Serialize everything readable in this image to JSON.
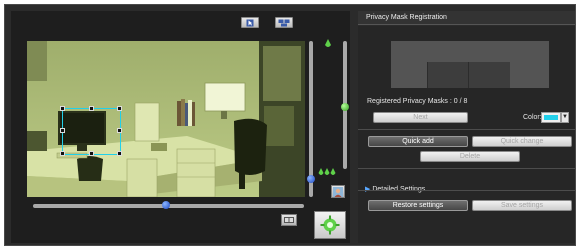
{
  "panel": {
    "title": "Privacy Mask Registration",
    "registered_label": "Registered Privacy Masks : 0 / 8",
    "next_label": "Next",
    "color_label": "Color:",
    "color_value": "#22d0ea",
    "dropdown_arrow": "▼",
    "quick_add_label": "Quick add",
    "quick_change_label": "Quick change",
    "delete_label": "Delete",
    "detailed_settings_label": "Detailed Settings",
    "expand_arrow": "▶",
    "restore_label": "Restore settings",
    "save_label": "Save settings"
  },
  "camera": {
    "view_toggle_icons": [
      "pointer-view-icon",
      "multi-view-icon"
    ],
    "zoom_slider_level": 0.49,
    "tilt_slider_level": 0.82,
    "side_slider_level": 0.38,
    "colors": {
      "tint": "#c8d49a",
      "bg": "#2b2b2b",
      "accent_green": "#5fd14a"
    }
  }
}
